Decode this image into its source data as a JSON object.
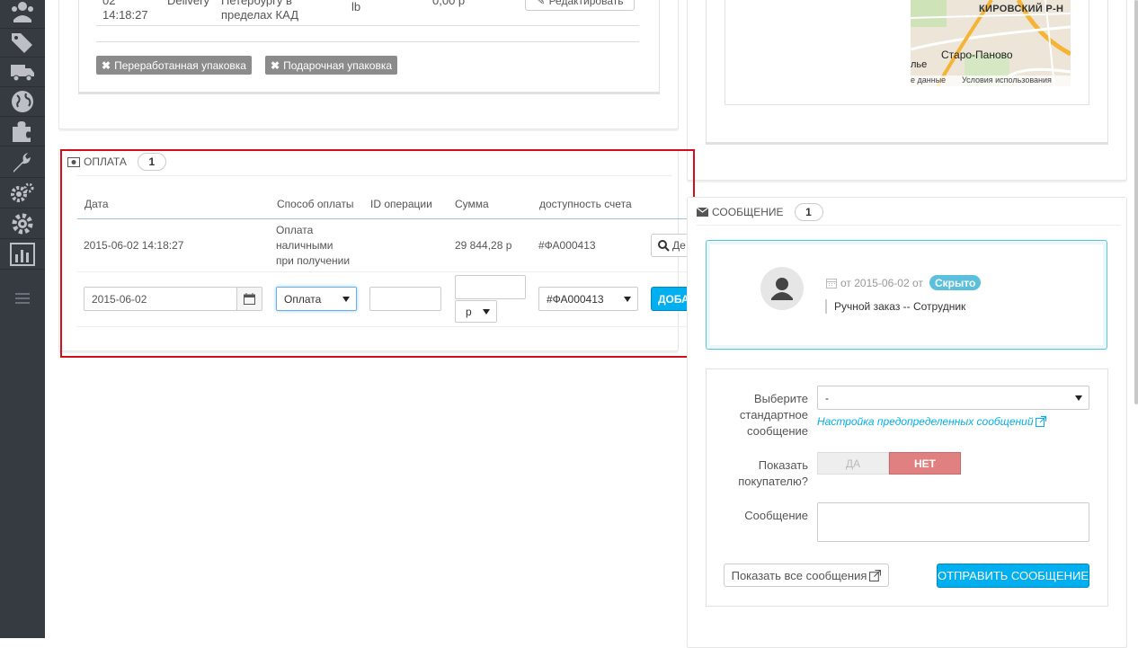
{
  "sidebar": {
    "icons": [
      "users-icon",
      "tags-icon",
      "truck-icon",
      "globe-icon",
      "puzzle-icon",
      "wrench-icon",
      "cogs-icon",
      "gear-icon",
      "stats-icon",
      "menu-icon"
    ]
  },
  "shipping_row": {
    "date_part": "02",
    "time": "14:18:27",
    "carrier": "Delivery",
    "desc_line1": "Петербургу в",
    "desc_line2": "пределах КАД",
    "weight_unit": "lb",
    "price": "0,00 р",
    "edit_label": "Редактировать"
  },
  "tags": [
    {
      "label": "Переработанная упаковка"
    },
    {
      "label": "Подарочная упаковка"
    }
  ],
  "map": {
    "district": "КИРОВСКИЙ Р-Н",
    "place": "Старо-Паново",
    "place_prefix": "льe",
    "footer_left": "е данные",
    "footer_right": "Условия использования"
  },
  "payment": {
    "title": "ОПЛАТА",
    "count": "1",
    "headers": {
      "date": "Дата",
      "method": "Способ оплаты",
      "op_id": "ID операции",
      "amount": "Сумма",
      "invoice": "доступность счета"
    },
    "row": {
      "date": "2015-06-02 14:18:27",
      "method_l1": "Оплата",
      "method_l2": "наличными",
      "method_l3": "при получении",
      "op_id": "",
      "amount": "29 844,28 р",
      "invoice": "#ФА000413",
      "details_label": "Де"
    },
    "form": {
      "date_value": "2015-06-02",
      "method_value": "Оплата",
      "op_id_value": "",
      "amount_value": "",
      "currency_value": "р",
      "invoice_value": "#ФА000413",
      "add_label": "ДОБА"
    }
  },
  "messages": {
    "title": "СООБЩЕНИЕ",
    "count": "1",
    "item": {
      "date_text": "от 2015-06-02 от",
      "status_badge": "Скрыто",
      "author": "Ручной заказ -- Сотрудник"
    },
    "form": {
      "template_label_l1": "Выберите",
      "template_label_l2": "стандартное",
      "template_label_l3": "сообщение",
      "template_value": "-",
      "template_link": "Настройка предопределенных сообщений",
      "show_label_l1": "Показать",
      "show_label_l2": "покупателю?",
      "yes_label": "ДА",
      "no_label": "НЕТ",
      "message_label": "Сообщение",
      "message_value": "",
      "show_all_label": "Показать все сообщения",
      "send_label": "ОТПРАВИТЬ СООБЩЕНИЕ"
    }
  },
  "colors": {
    "sidebar_bg": "#363a41",
    "accent": "#00aff0",
    "no_toggle": "#e08080",
    "highlight_frame": "#d10f1a",
    "tag_bg": "#8b8b8b"
  }
}
